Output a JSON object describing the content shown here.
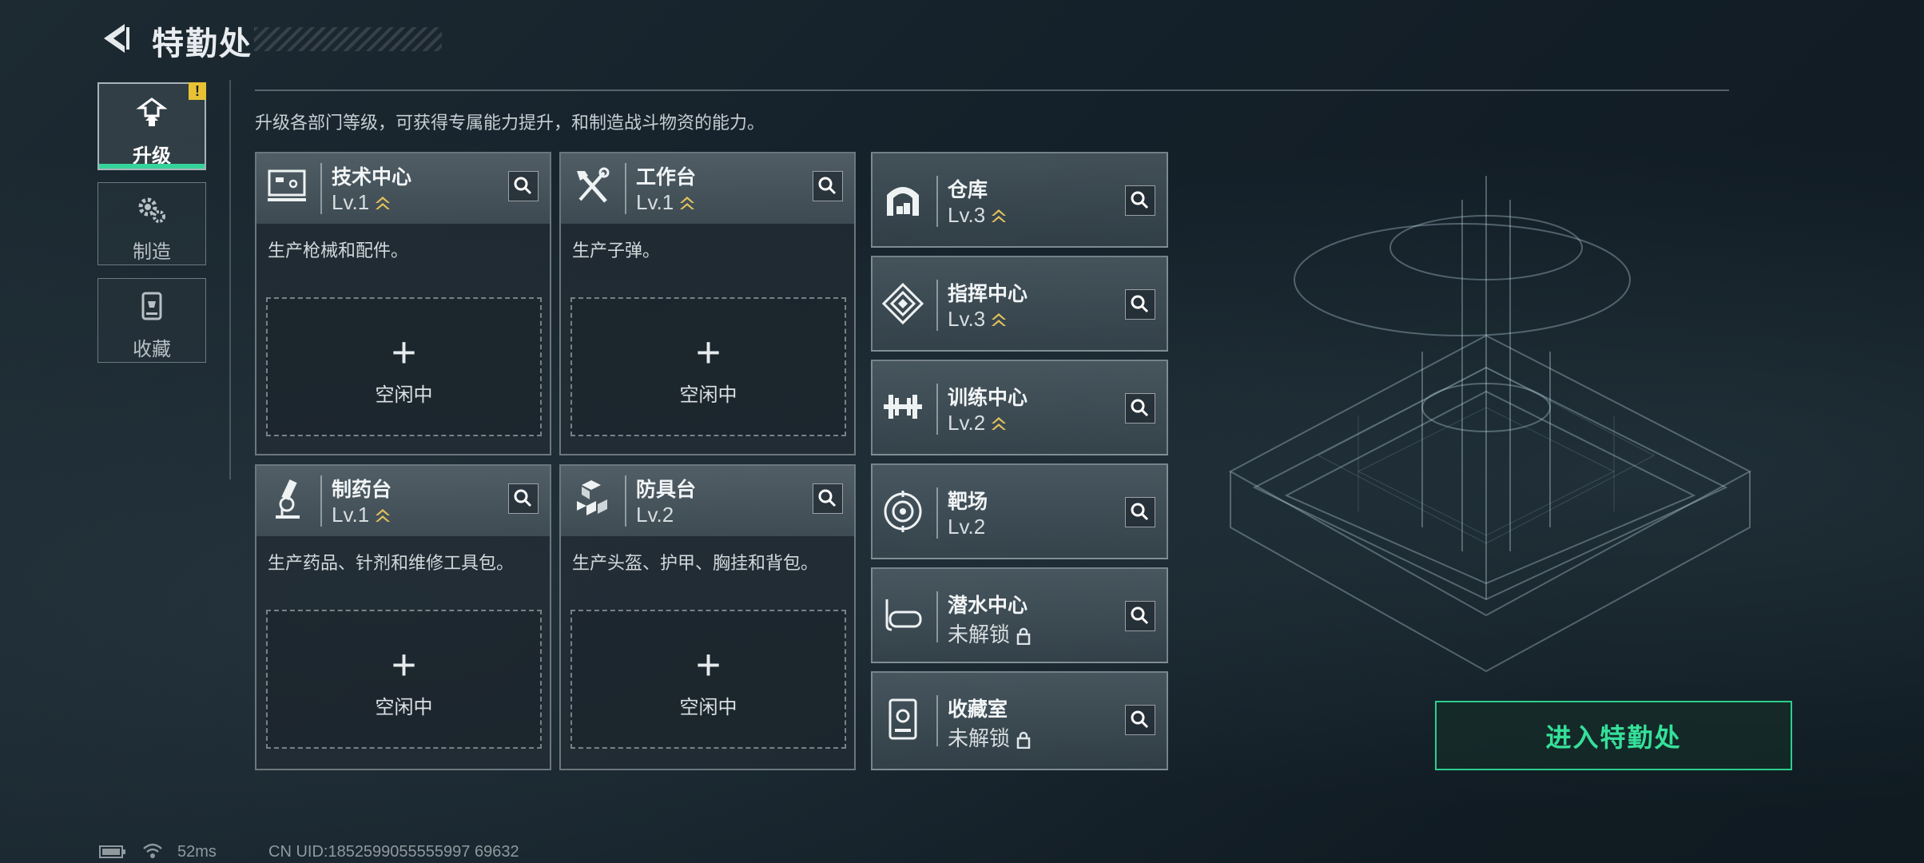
{
  "header": {
    "title": "特勤处",
    "back_icon": "back-arrow-icon"
  },
  "sidebar": {
    "tabs": [
      {
        "label": "升级",
        "icon": "upgrade-icon",
        "active": true,
        "alert": "!"
      },
      {
        "label": "制造",
        "icon": "gears-icon",
        "active": false
      },
      {
        "label": "收藏",
        "icon": "trophy-case-icon",
        "active": false
      }
    ]
  },
  "main": {
    "description": "升级各部门等级，可获得专属能力提升，和制造战斗物资的能力。",
    "cards": [
      {
        "name": "技术中心",
        "level": "Lv.1",
        "upgradable": true,
        "text": "生产枪械和配件。",
        "slot_label": "空闲中",
        "icon": "computer-icon"
      },
      {
        "name": "工作台",
        "level": "Lv.1",
        "upgradable": true,
        "text": "生产子弹。",
        "slot_label": "空闲中",
        "icon": "tools-icon"
      },
      {
        "name": "制药台",
        "level": "Lv.1",
        "upgradable": true,
        "text": "生产药品、针剂和维修工具包。",
        "slot_label": "空闲中",
        "icon": "microscope-icon"
      },
      {
        "name": "防具台",
        "level": "Lv.2",
        "upgradable": false,
        "text": "生产头盔、护甲、胸挂和背包。",
        "slot_label": "空闲中",
        "icon": "armor-blocks-icon"
      }
    ],
    "facilities": [
      {
        "name": "仓库",
        "level": "Lv.3",
        "upgradable": true,
        "locked": false,
        "icon": "warehouse-icon"
      },
      {
        "name": "指挥中心",
        "level": "Lv.3",
        "upgradable": true,
        "locked": false,
        "icon": "command-icon"
      },
      {
        "name": "训练中心",
        "level": "Lv.2",
        "upgradable": true,
        "locked": false,
        "icon": "dumbbell-icon"
      },
      {
        "name": "靶场",
        "level": "Lv.2",
        "upgradable": false,
        "locked": false,
        "icon": "target-icon"
      },
      {
        "name": "潜水中心",
        "level": "未解锁",
        "upgradable": false,
        "locked": true,
        "icon": "diving-mask-icon"
      },
      {
        "name": "收藏室",
        "level": "未解锁",
        "upgradable": false,
        "locked": true,
        "icon": "collection-icon"
      }
    ],
    "enter_button": "进入特勤处"
  },
  "status_bar": {
    "ping": "52ms",
    "uid": "CN UID:1852599055555997 69632"
  },
  "colors": {
    "accent": "#35d49a",
    "upgrade_arrow": "#e2c25c",
    "alert": "#e8c234"
  }
}
